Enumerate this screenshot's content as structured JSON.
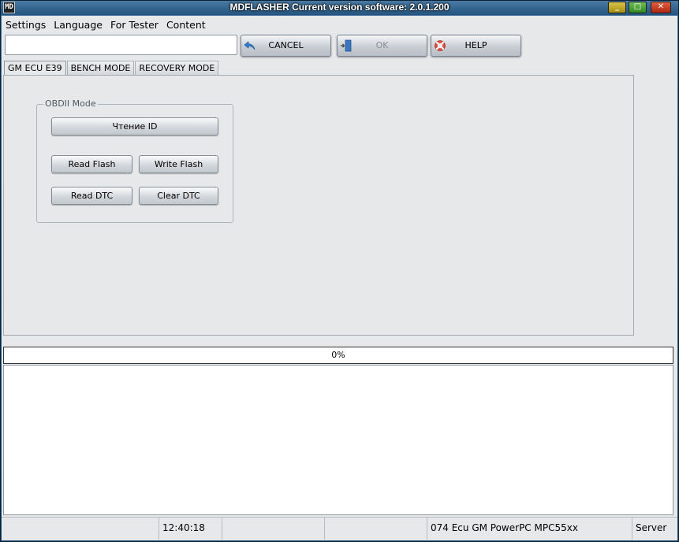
{
  "window": {
    "title": "MDFLASHER  Current version software: 2.0.1.200",
    "icon_text": "MD",
    "controls": {
      "minimize": "minimize-icon",
      "maximize": "maximize-icon",
      "close": "close-icon"
    }
  },
  "menu": [
    "Settings",
    "Language",
    "For Tester",
    "Content"
  ],
  "toolbar": {
    "input_value": "",
    "cancel_label": "CANCEL",
    "ok_label": "OK",
    "help_label": "HELP",
    "icons": {
      "cancel": "undo-arrow-icon",
      "ok": "exit-door-icon",
      "help": "lifebuoy-icon"
    }
  },
  "tabs": [
    "GM ECU E39",
    "BENCH MODE",
    "RECOVERY MODE"
  ],
  "active_tab": "GM ECU E39",
  "obd_group": {
    "title": "OBDII Mode",
    "read_id": "Чтение ID",
    "read_flash": "Read Flash",
    "write_flash": "Write Flash",
    "read_dtc": "Read DTC",
    "clear_dtc": "Clear DTC"
  },
  "progress": {
    "value": 0,
    "label": "0%"
  },
  "status": {
    "cell1": "",
    "time": "12:40:18",
    "cell3": "",
    "cell4": "",
    "ecu": "074 Ecu GM PowerPC MPC55xx",
    "server": "Server"
  },
  "colors": {
    "accent": "#3a7bd5",
    "titlebar": "#23557f",
    "panel": "#e6e8ea"
  }
}
